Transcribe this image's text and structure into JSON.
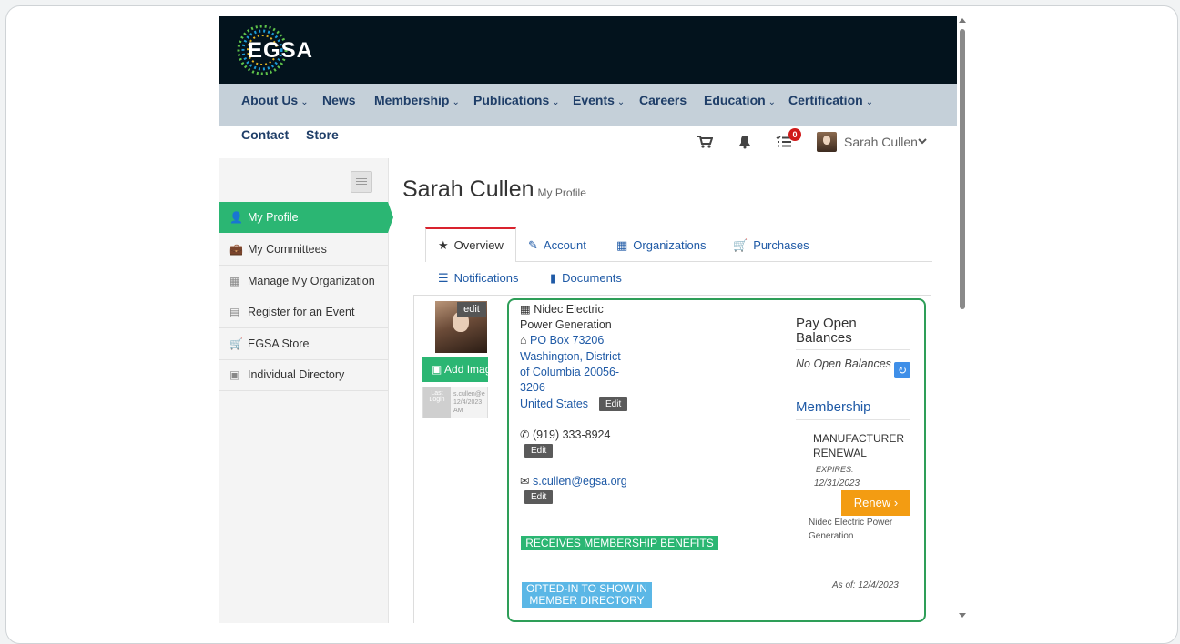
{
  "brand": {
    "logo_text": "EGSA"
  },
  "nav": {
    "items": [
      {
        "label": "About Us",
        "dropdown": true
      },
      {
        "label": "News",
        "dropdown": false
      },
      {
        "label": "Membership",
        "dropdown": true
      },
      {
        "label": "Publications",
        "dropdown": true
      },
      {
        "label": "Events",
        "dropdown": true
      },
      {
        "label": "Careers",
        "dropdown": false
      },
      {
        "label": "Education",
        "dropdown": true
      },
      {
        "label": "Certification",
        "dropdown": true
      }
    ],
    "row2": [
      {
        "label": "Contact"
      },
      {
        "label": "Store"
      }
    ],
    "chev": "⌄"
  },
  "user": {
    "name": "Sarah Cullen",
    "task_count": "0"
  },
  "sidebar": {
    "items": [
      {
        "label": "My Profile",
        "icon": "user-icon",
        "glyph": "👤"
      },
      {
        "label": "My Committees",
        "icon": "briefcase-icon",
        "glyph": "💼"
      },
      {
        "label": "Manage My Organization",
        "icon": "building-icon",
        "glyph": "▦"
      },
      {
        "label": "Register for an Event",
        "icon": "calendar-icon",
        "glyph": "▤"
      },
      {
        "label": "EGSA Store",
        "icon": "cart-icon",
        "glyph": "🛒"
      },
      {
        "label": "Individual Directory",
        "icon": "book-icon",
        "glyph": "▣"
      }
    ]
  },
  "page": {
    "title": "Sarah Cullen",
    "subtitle": "My Profile"
  },
  "tabs": [
    {
      "label": "Overview",
      "icon": "star-icon",
      "glyph": "★"
    },
    {
      "label": "Account",
      "icon": "edit-icon",
      "glyph": "✎"
    },
    {
      "label": "Organizations",
      "icon": "building-icon",
      "glyph": "▦"
    },
    {
      "label": "Purchases",
      "icon": "cart-icon",
      "glyph": "🛒"
    },
    {
      "label": "Notifications",
      "icon": "list-icon",
      "glyph": "☰"
    },
    {
      "label": "Documents",
      "icon": "documents-icon",
      "glyph": "▮"
    }
  ],
  "profile": {
    "photo_edit": "edit",
    "add_image": "Add Image",
    "last_login_label": "Last Login",
    "last_login_value": "s.cullen@e 12/4/2023 AM"
  },
  "contact": {
    "org_line1": "Nidec Electric",
    "org_line2": "Power Generation",
    "addr1": "PO Box 73206",
    "addr2": "Washington, District",
    "addr3": "of Columbia 20056-",
    "addr4": "3206",
    "country": "United States",
    "phone": "(919) 333-8924",
    "email": "s.cullen@egsa.org",
    "edit_label": "Edit",
    "benefits_badge": "RECEIVES MEMBERSHIP BENEFITS",
    "directory_badge_1": "OPTED-IN TO SHOW IN",
    "directory_badge_2": "MEMBER DIRECTORY"
  },
  "balances": {
    "title_line1": "Pay Open",
    "title_line2": "Balances",
    "status": "No Open Balances"
  },
  "membership": {
    "title": "Membership",
    "type_line1": "MANUFACTURER",
    "type_line2": "RENEWAL",
    "expires_label": "EXPIRES:",
    "expires_date": "12/31/2023",
    "renew_label": "Renew",
    "org_line1": "Nidec Electric Power",
    "org_line2": "Generation",
    "as_of": "As of: 12/4/2023"
  }
}
